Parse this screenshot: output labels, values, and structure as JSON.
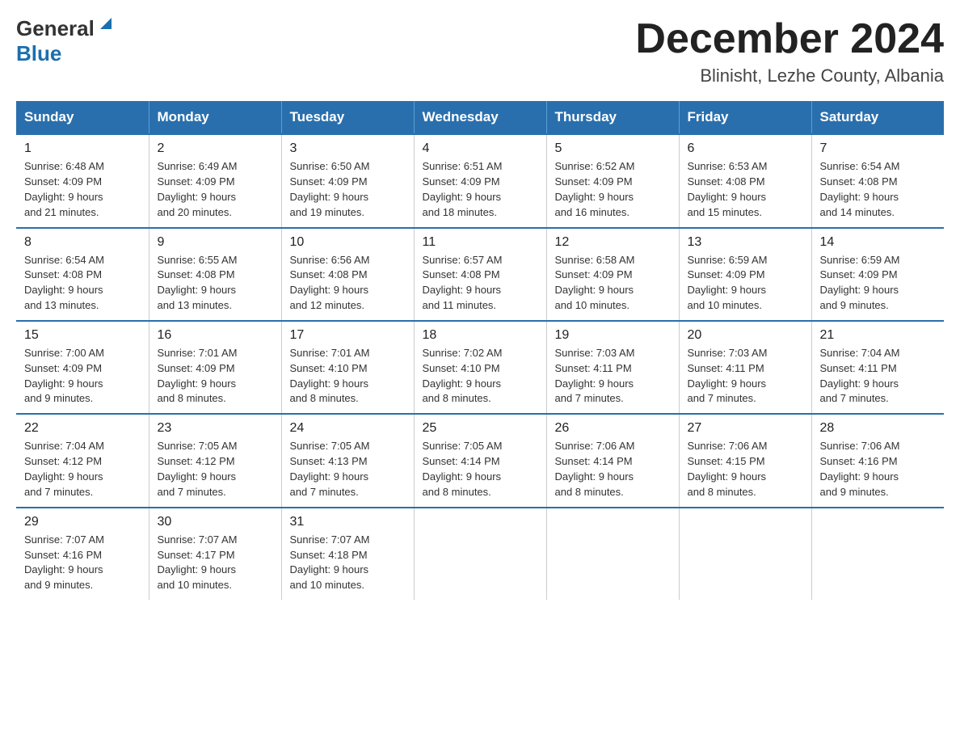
{
  "header": {
    "logo_general": "General",
    "logo_blue": "Blue",
    "month_title": "December 2024",
    "location": "Blinisht, Lezhe County, Albania"
  },
  "days_of_week": [
    "Sunday",
    "Monday",
    "Tuesday",
    "Wednesday",
    "Thursday",
    "Friday",
    "Saturday"
  ],
  "weeks": [
    [
      {
        "date": "1",
        "sunrise": "6:48 AM",
        "sunset": "4:09 PM",
        "daylight": "9 hours and 21 minutes."
      },
      {
        "date": "2",
        "sunrise": "6:49 AM",
        "sunset": "4:09 PM",
        "daylight": "9 hours and 20 minutes."
      },
      {
        "date": "3",
        "sunrise": "6:50 AM",
        "sunset": "4:09 PM",
        "daylight": "9 hours and 19 minutes."
      },
      {
        "date": "4",
        "sunrise": "6:51 AM",
        "sunset": "4:09 PM",
        "daylight": "9 hours and 18 minutes."
      },
      {
        "date": "5",
        "sunrise": "6:52 AM",
        "sunset": "4:09 PM",
        "daylight": "9 hours and 16 minutes."
      },
      {
        "date": "6",
        "sunrise": "6:53 AM",
        "sunset": "4:08 PM",
        "daylight": "9 hours and 15 minutes."
      },
      {
        "date": "7",
        "sunrise": "6:54 AM",
        "sunset": "4:08 PM",
        "daylight": "9 hours and 14 minutes."
      }
    ],
    [
      {
        "date": "8",
        "sunrise": "6:54 AM",
        "sunset": "4:08 PM",
        "daylight": "9 hours and 13 minutes."
      },
      {
        "date": "9",
        "sunrise": "6:55 AM",
        "sunset": "4:08 PM",
        "daylight": "9 hours and 13 minutes."
      },
      {
        "date": "10",
        "sunrise": "6:56 AM",
        "sunset": "4:08 PM",
        "daylight": "9 hours and 12 minutes."
      },
      {
        "date": "11",
        "sunrise": "6:57 AM",
        "sunset": "4:08 PM",
        "daylight": "9 hours and 11 minutes."
      },
      {
        "date": "12",
        "sunrise": "6:58 AM",
        "sunset": "4:09 PM",
        "daylight": "9 hours and 10 minutes."
      },
      {
        "date": "13",
        "sunrise": "6:59 AM",
        "sunset": "4:09 PM",
        "daylight": "9 hours and 10 minutes."
      },
      {
        "date": "14",
        "sunrise": "6:59 AM",
        "sunset": "4:09 PM",
        "daylight": "9 hours and 9 minutes."
      }
    ],
    [
      {
        "date": "15",
        "sunrise": "7:00 AM",
        "sunset": "4:09 PM",
        "daylight": "9 hours and 9 minutes."
      },
      {
        "date": "16",
        "sunrise": "7:01 AM",
        "sunset": "4:09 PM",
        "daylight": "9 hours and 8 minutes."
      },
      {
        "date": "17",
        "sunrise": "7:01 AM",
        "sunset": "4:10 PM",
        "daylight": "9 hours and 8 minutes."
      },
      {
        "date": "18",
        "sunrise": "7:02 AM",
        "sunset": "4:10 PM",
        "daylight": "9 hours and 8 minutes."
      },
      {
        "date": "19",
        "sunrise": "7:03 AM",
        "sunset": "4:11 PM",
        "daylight": "9 hours and 7 minutes."
      },
      {
        "date": "20",
        "sunrise": "7:03 AM",
        "sunset": "4:11 PM",
        "daylight": "9 hours and 7 minutes."
      },
      {
        "date": "21",
        "sunrise": "7:04 AM",
        "sunset": "4:11 PM",
        "daylight": "9 hours and 7 minutes."
      }
    ],
    [
      {
        "date": "22",
        "sunrise": "7:04 AM",
        "sunset": "4:12 PM",
        "daylight": "9 hours and 7 minutes."
      },
      {
        "date": "23",
        "sunrise": "7:05 AM",
        "sunset": "4:12 PM",
        "daylight": "9 hours and 7 minutes."
      },
      {
        "date": "24",
        "sunrise": "7:05 AM",
        "sunset": "4:13 PM",
        "daylight": "9 hours and 7 minutes."
      },
      {
        "date": "25",
        "sunrise": "7:05 AM",
        "sunset": "4:14 PM",
        "daylight": "9 hours and 8 minutes."
      },
      {
        "date": "26",
        "sunrise": "7:06 AM",
        "sunset": "4:14 PM",
        "daylight": "9 hours and 8 minutes."
      },
      {
        "date": "27",
        "sunrise": "7:06 AM",
        "sunset": "4:15 PM",
        "daylight": "9 hours and 8 minutes."
      },
      {
        "date": "28",
        "sunrise": "7:06 AM",
        "sunset": "4:16 PM",
        "daylight": "9 hours and 9 minutes."
      }
    ],
    [
      {
        "date": "29",
        "sunrise": "7:07 AM",
        "sunset": "4:16 PM",
        "daylight": "9 hours and 9 minutes."
      },
      {
        "date": "30",
        "sunrise": "7:07 AM",
        "sunset": "4:17 PM",
        "daylight": "9 hours and 10 minutes."
      },
      {
        "date": "31",
        "sunrise": "7:07 AM",
        "sunset": "4:18 PM",
        "daylight": "9 hours and 10 minutes."
      },
      null,
      null,
      null,
      null
    ]
  ]
}
